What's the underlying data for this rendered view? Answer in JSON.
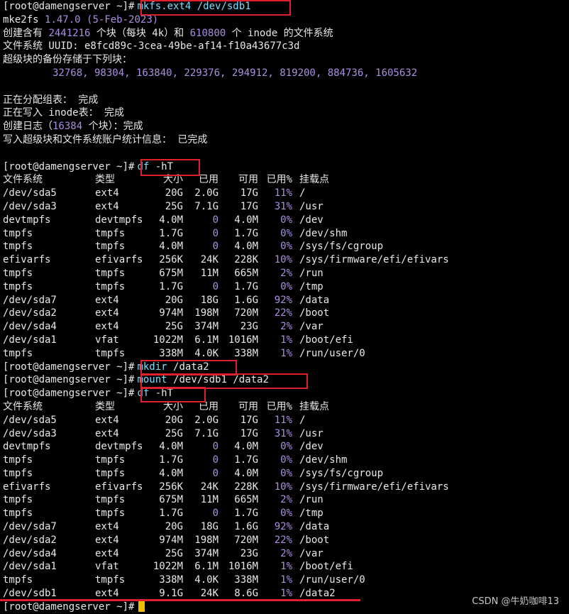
{
  "prompt": "[root@damengserver ~]#",
  "commands": {
    "mkfs": {
      "prog": "mkfs.ext4",
      "arg": "/dev/sdb1"
    },
    "df1": {
      "prog": "df",
      "arg": "-hT"
    },
    "mkdir": {
      "prog": "mkdir",
      "arg": "/data2"
    },
    "mount": {
      "prog": "mount",
      "arg": "/dev/sdb1 /data2"
    },
    "df2": {
      "prog": "df",
      "arg": "-hT"
    }
  },
  "mkfs_output": {
    "version_prefix": "mke2fs ",
    "version": "1.47.0",
    "date": "(5-Feb-2023)",
    "line2_a": "创建含有 ",
    "line2_blocks": "2441216",
    "line2_b": " 个块（每块 4k）和 ",
    "line2_inodes": "610800",
    "line2_c": " 个 inode 的文件系统",
    "uuid_line": "文件系统 UUID: e8fcd89c-3cea-49be-af14-f10a43677c3d",
    "backup_title": "超级块的备份存储于下列块：",
    "backup_blocks": "32768, 98304, 163840, 229376, 294912, 819200, 884736, 1605632",
    "status1": "正在分配组表： 完成",
    "status2": "正在写入 inode表： 完成",
    "status3_a": "创建日志（",
    "status3_num": "16384",
    "status3_b": " 个块）：完成",
    "status4": "写入超级块和文件系统账户统计信息： 已完成"
  },
  "df_header": [
    "文件系统",
    "类型",
    "大小",
    "已用",
    "可用",
    "已用%",
    "挂载点"
  ],
  "df1_rows": [
    [
      "/dev/sda5",
      "ext4",
      "20G",
      "2.0G",
      "17G",
      "11%",
      "/"
    ],
    [
      "/dev/sda3",
      "ext4",
      "25G",
      "7.1G",
      "17G",
      "31%",
      "/usr"
    ],
    [
      "devtmpfs",
      "devtmpfs",
      "4.0M",
      "0",
      "4.0M",
      "0%",
      "/dev"
    ],
    [
      "tmpfs",
      "tmpfs",
      "1.7G",
      "0",
      "1.7G",
      "0%",
      "/dev/shm"
    ],
    [
      "tmpfs",
      "tmpfs",
      "4.0M",
      "0",
      "4.0M",
      "0%",
      "/sys/fs/cgroup"
    ],
    [
      "efivarfs",
      "efivarfs",
      "256K",
      "24K",
      "228K",
      "10%",
      "/sys/firmware/efi/efivars"
    ],
    [
      "tmpfs",
      "tmpfs",
      "675M",
      "11M",
      "665M",
      "2%",
      "/run"
    ],
    [
      "tmpfs",
      "tmpfs",
      "1.7G",
      "0",
      "1.7G",
      "0%",
      "/tmp"
    ],
    [
      "/dev/sda7",
      "ext4",
      "20G",
      "18G",
      "1.6G",
      "92%",
      "/data"
    ],
    [
      "/dev/sda2",
      "ext4",
      "974M",
      "198M",
      "720M",
      "22%",
      "/boot"
    ],
    [
      "/dev/sda4",
      "ext4",
      "25G",
      "374M",
      "23G",
      "2%",
      "/var"
    ],
    [
      "/dev/sda1",
      "vfat",
      "1022M",
      "6.1M",
      "1016M",
      "1%",
      "/boot/efi"
    ],
    [
      "tmpfs",
      "tmpfs",
      "338M",
      "4.0K",
      "338M",
      "1%",
      "/run/user/0"
    ]
  ],
  "df2_rows": [
    [
      "/dev/sda5",
      "ext4",
      "20G",
      "2.0G",
      "17G",
      "11%",
      "/"
    ],
    [
      "/dev/sda3",
      "ext4",
      "25G",
      "7.1G",
      "17G",
      "31%",
      "/usr"
    ],
    [
      "devtmpfs",
      "devtmpfs",
      "4.0M",
      "0",
      "4.0M",
      "0%",
      "/dev"
    ],
    [
      "tmpfs",
      "tmpfs",
      "1.7G",
      "0",
      "1.7G",
      "0%",
      "/dev/shm"
    ],
    [
      "tmpfs",
      "tmpfs",
      "4.0M",
      "0",
      "4.0M",
      "0%",
      "/sys/fs/cgroup"
    ],
    [
      "efivarfs",
      "efivarfs",
      "256K",
      "24K",
      "228K",
      "10%",
      "/sys/firmware/efi/efivars"
    ],
    [
      "tmpfs",
      "tmpfs",
      "675M",
      "11M",
      "665M",
      "2%",
      "/run"
    ],
    [
      "tmpfs",
      "tmpfs",
      "1.7G",
      "0",
      "1.7G",
      "0%",
      "/tmp"
    ],
    [
      "/dev/sda7",
      "ext4",
      "20G",
      "18G",
      "1.6G",
      "92%",
      "/data"
    ],
    [
      "/dev/sda2",
      "ext4",
      "974M",
      "198M",
      "720M",
      "22%",
      "/boot"
    ],
    [
      "/dev/sda4",
      "ext4",
      "25G",
      "374M",
      "23G",
      "2%",
      "/var"
    ],
    [
      "/dev/sda1",
      "vfat",
      "1022M",
      "6.1M",
      "1016M",
      "1%",
      "/boot/efi"
    ],
    [
      "tmpfs",
      "tmpfs",
      "338M",
      "4.0K",
      "338M",
      "1%",
      "/run/user/0"
    ],
    [
      "/dev/sdb1",
      "ext4",
      "9.1G",
      "24K",
      "8.6G",
      "1%",
      "/data2"
    ]
  ],
  "watermark": "CSDN @牛奶咖啡13",
  "colors": {
    "highlight": "#e0202a",
    "command": "#7fdcff",
    "number": "#a98fe0",
    "cursor": "#f0c000"
  }
}
